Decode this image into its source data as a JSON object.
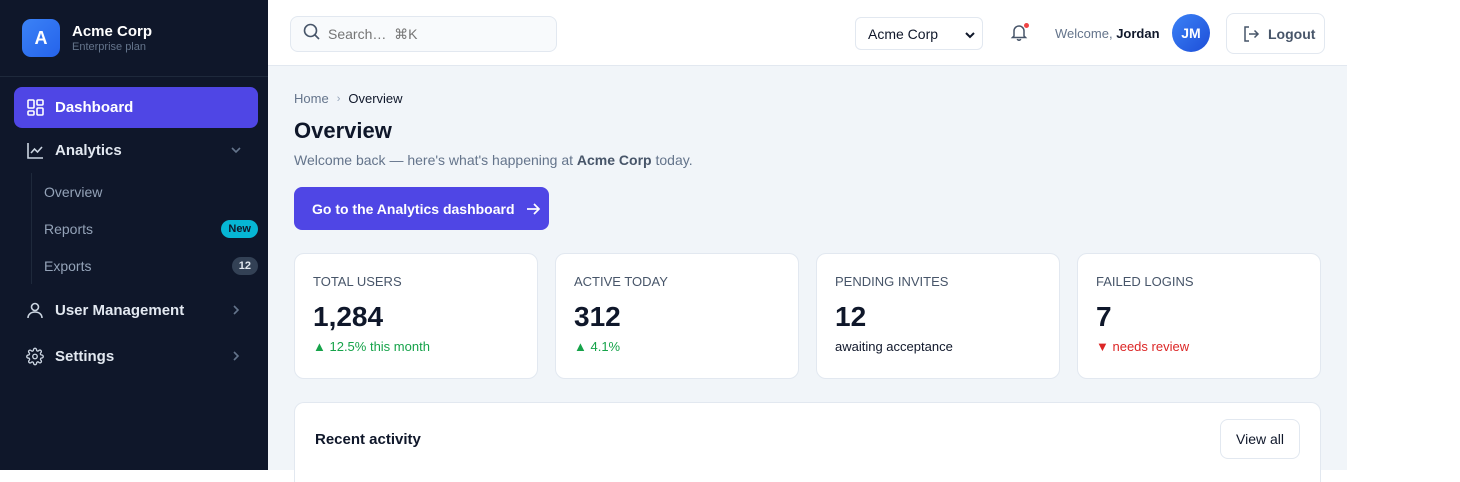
{
  "brand": {
    "logo_letter": "A",
    "name": "Acme Corp",
    "plan": "Enterprise plan"
  },
  "sidebar": {
    "items": [
      {
        "label": "Dashboard",
        "icon": "dashboard-icon",
        "active": true
      },
      {
        "label": "Analytics",
        "icon": "chart-line-icon",
        "expanded": true,
        "children": [
          {
            "label": "Overview"
          },
          {
            "label": "Reports",
            "badge": "New"
          },
          {
            "label": "Exports",
            "badge": "12"
          }
        ]
      },
      {
        "label": "User Management",
        "icon": "user-icon"
      },
      {
        "label": "Settings",
        "icon": "gear-icon"
      }
    ]
  },
  "topbar": {
    "search_placeholder": "Search…  ⌘K",
    "org_selected": "Acme Corp",
    "welcome_prefix": "Welcome,",
    "user_name": "Jordan",
    "avatar_initials": "JM",
    "logout_label": "Logout"
  },
  "breadcrumb": {
    "home": "Home",
    "current": "Overview"
  },
  "page": {
    "title": "Overview",
    "subtitle_prefix": "Welcome back — here's what's happening at",
    "subtitle_org": "Acme Corp",
    "subtitle_suffix": "today.",
    "cta_label": "Go to the Analytics dashboard"
  },
  "stats": [
    {
      "label": "TOTAL USERS",
      "value": "1,284",
      "note": "▲ 12.5% this month",
      "trend": "up"
    },
    {
      "label": "ACTIVE TODAY",
      "value": "312",
      "note": "▲ 4.1%",
      "trend": "up"
    },
    {
      "label": "PENDING INVITES",
      "value": "12",
      "note": "awaiting acceptance",
      "trend": "neutral"
    },
    {
      "label": "FAILED LOGINS",
      "value": "7",
      "note": "▼ needs review",
      "trend": "down"
    }
  ],
  "activity": {
    "title": "Recent activity",
    "view_all_label": "View all"
  },
  "colors": {
    "sidebar_bg": "#0f172a",
    "accent": "#4f46e5",
    "up": "#16a34a",
    "down": "#dc2626",
    "badge_new": "#06b6d4"
  }
}
